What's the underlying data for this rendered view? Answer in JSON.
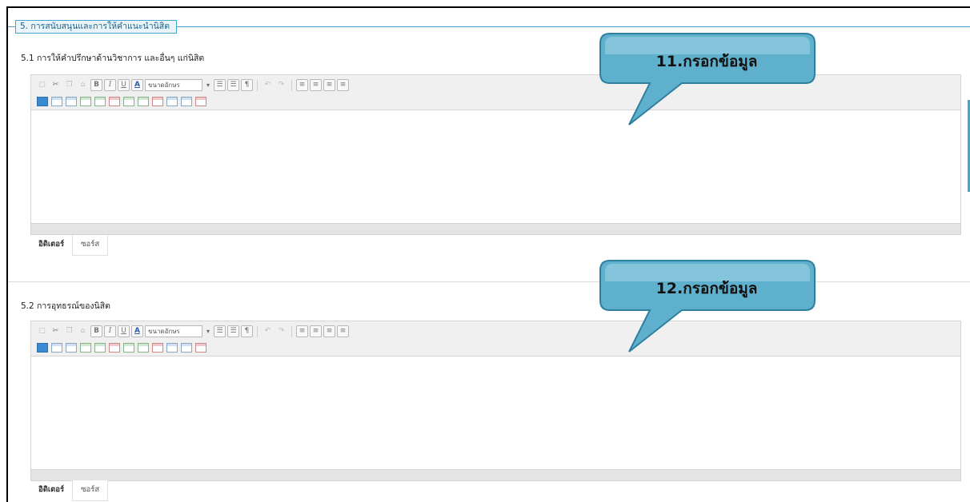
{
  "section": {
    "legend": "5. การสนับสนุนและการให้คำแนะนำนิสิต"
  },
  "fields": [
    {
      "label": "5.1 การให้คำปรึกษาด้านวิชาการ และอื่นๆ แก่นิสิต",
      "font_size_placeholder": "ขนาดอักษร",
      "tabs": {
        "editor": "อิดิเตอร์",
        "source": "ซอร์ส"
      },
      "callout": "11.กรอกข้อมูล"
    },
    {
      "label": "5.2 การอุทธรณ์ของนิสิต",
      "font_size_placeholder": "ขนาดอักษร",
      "tabs": {
        "editor": "อิดิเตอร์",
        "source": "ซอร์ส"
      },
      "callout": "12.กรอกข้อมูล"
    }
  ],
  "colors": {
    "accent": "#4aa3cf",
    "callout_fill": "#5fb0cc",
    "callout_stroke": "#2f7fa0"
  },
  "toolbar_icons": [
    "new-page-icon",
    "cut-icon",
    "copy-icon",
    "paste-icon",
    "bold-icon",
    "italic-icon",
    "underline-icon",
    "text-color-icon",
    "ordered-list-icon",
    "unordered-list-icon",
    "paragraph-icon",
    "undo-icon",
    "redo-icon",
    "align-left-icon",
    "align-center-icon",
    "align-right-icon",
    "justify-icon",
    "table-icon"
  ]
}
